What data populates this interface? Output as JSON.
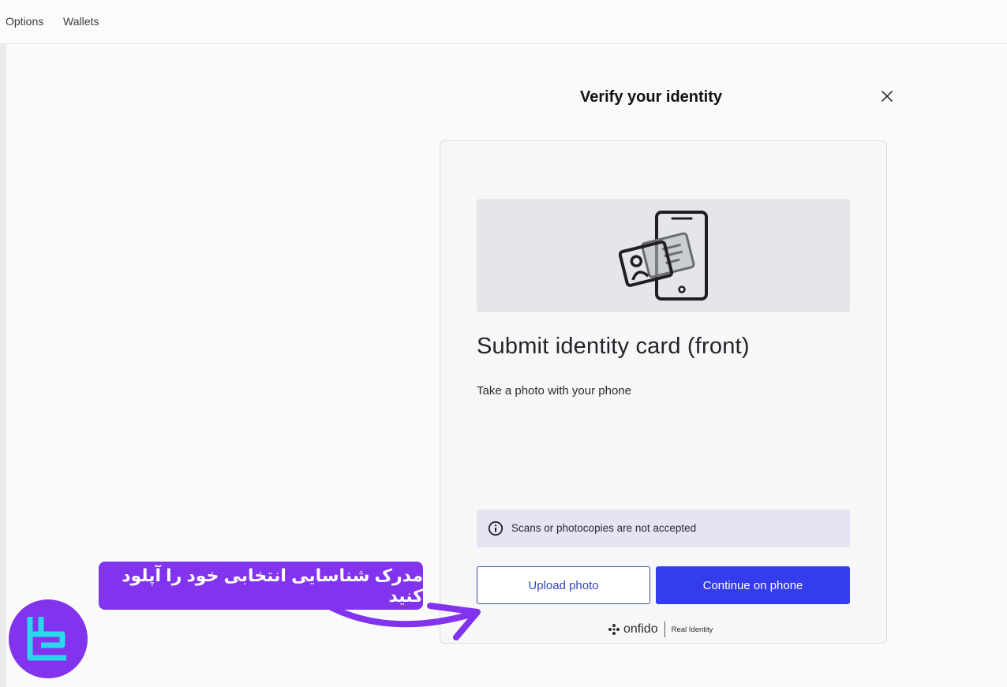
{
  "topbar": {
    "items": [
      "Options",
      "Wallets"
    ]
  },
  "modal": {
    "title": "Verify your identity",
    "close_icon": "close-icon"
  },
  "card": {
    "illustration_icon": "id-card-phone-icon",
    "heading": "Submit identity card (front)",
    "subtitle": "Take a photo with your phone",
    "notice": {
      "icon": "info-icon",
      "text": "Scans or photocopies are not accepted"
    },
    "upload_label": "Upload photo",
    "continue_label": "Continue on phone",
    "brand": {
      "name": "onfido",
      "tag": "Real Identity"
    }
  },
  "annotation": {
    "text": "مدرک شناسایی انتخابی خود را آپلود کنید",
    "color": "#8133ed"
  },
  "colors": {
    "primary": "#353ceb",
    "notice_bg": "#e4e4f5",
    "accent": "#8133ed"
  }
}
